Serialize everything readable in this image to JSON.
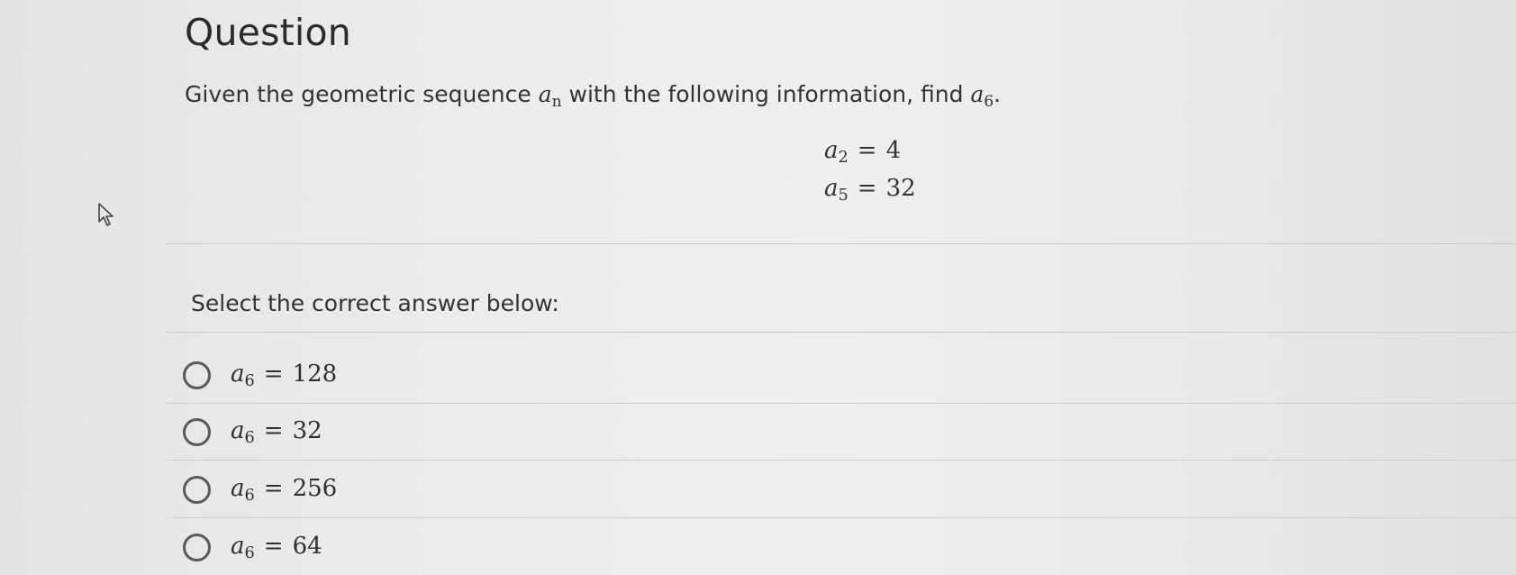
{
  "question": {
    "title": "Question",
    "prompt_prefix": "Given the geometric sequence ",
    "prompt_var": "a",
    "prompt_var_sub": "n",
    "prompt_middle": " with the following information, find ",
    "prompt_target": "a",
    "prompt_target_sub": "6",
    "prompt_suffix": "."
  },
  "given": [
    {
      "var": "a",
      "sub": "2",
      "eq": "=",
      "value": "4"
    },
    {
      "var": "a",
      "sub": "5",
      "eq": "=",
      "value": "32"
    }
  ],
  "select_label": "Select the correct answer below:",
  "options": [
    {
      "var": "a",
      "sub": "6",
      "eq": "=",
      "value": "128"
    },
    {
      "var": "a",
      "sub": "6",
      "eq": "=",
      "value": "32"
    },
    {
      "var": "a",
      "sub": "6",
      "eq": "=",
      "value": "256"
    },
    {
      "var": "a",
      "sub": "6",
      "eq": "=",
      "value": "64"
    }
  ],
  "icons": {
    "cursor": "mouse-pointer-icon",
    "option_marker": "radio-button-unselected"
  },
  "colors": {
    "background": "#ececec",
    "text": "#2e2e2e",
    "divider": "#c9c9c9",
    "radio_border": "#5a5a5a"
  }
}
